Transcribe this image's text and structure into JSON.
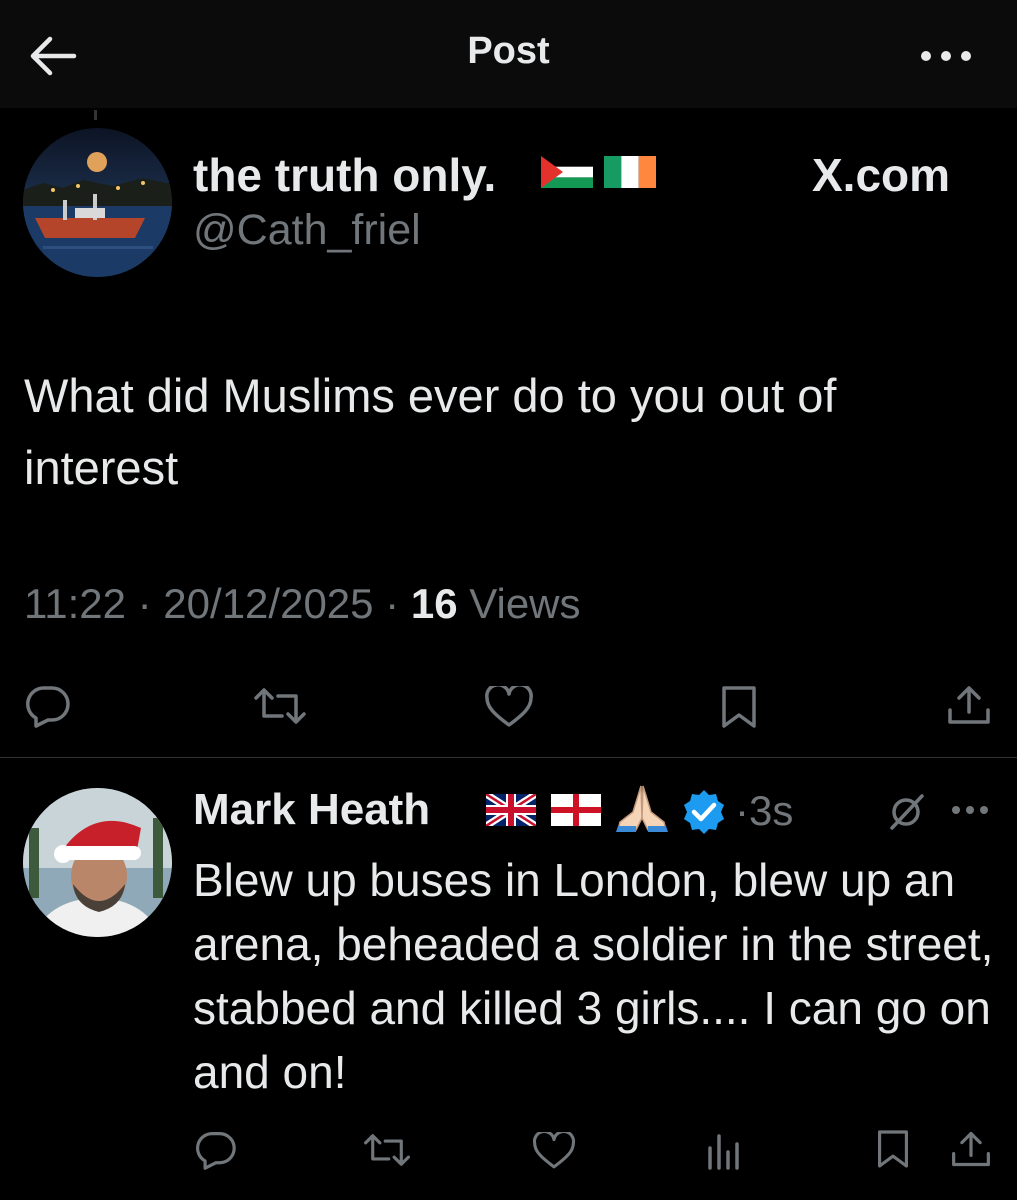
{
  "header": {
    "title": "Post"
  },
  "tweet": {
    "display_name": "the truth only.",
    "handle": "@Cath_friel",
    "source_label": "X.com",
    "text": "What did Muslims ever do to you out of interest",
    "time": "11:22 · 20/12/2025 ·",
    "views_count": "16",
    "views_label": "Views"
  },
  "reply": {
    "display_name": "Mark Heath",
    "time": "·3s",
    "text": "Blew up buses in London, blew up an arena, beheaded a soldier in the street, stabbed and killed 3 girls.... I can go on and on!"
  },
  "colors": {
    "background": "#000000",
    "primary_text": "#e7e9ea",
    "secondary_text": "#71767b",
    "verified": "#1d9bf0",
    "divider": "#2f3336"
  },
  "icons": {
    "header": [
      "back-arrow-icon",
      "more-icon"
    ],
    "actions": [
      "reply-icon",
      "repost-icon",
      "like-icon",
      "bookmark-icon",
      "share-icon"
    ],
    "reply_actions": [
      "reply-icon",
      "repost-icon",
      "like-icon",
      "views-icon",
      "bookmark-icon",
      "share-icon"
    ]
  }
}
